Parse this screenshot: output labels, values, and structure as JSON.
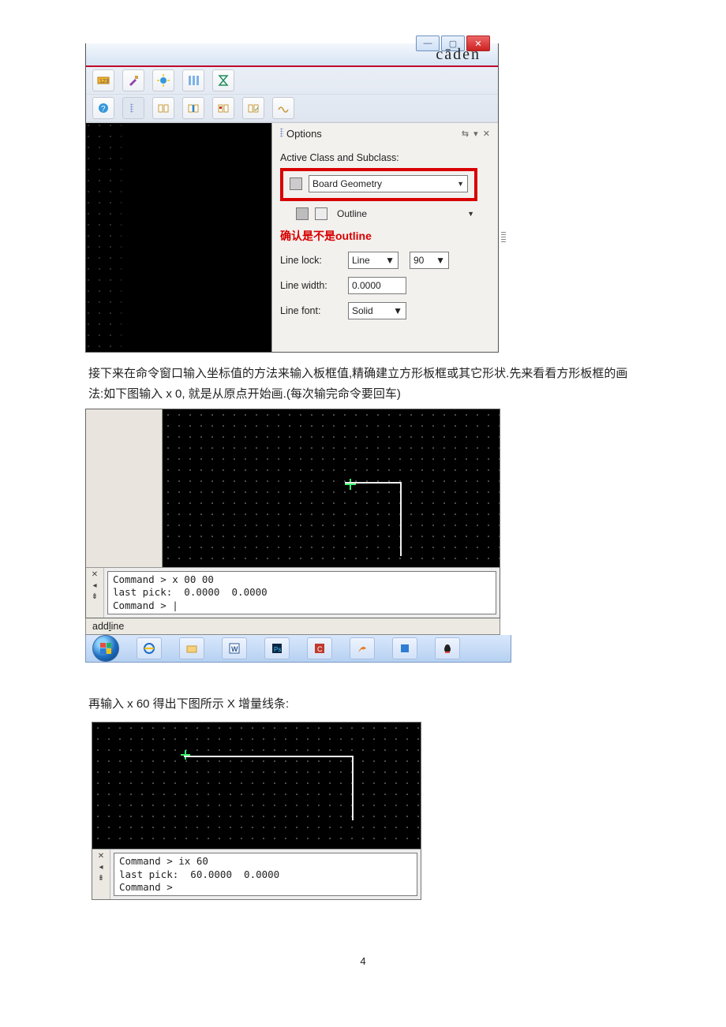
{
  "brand": "cāden",
  "options": {
    "title": "Options",
    "subclassLabel": "Active Class and Subclass:",
    "class": "Board Geometry",
    "subclass": "Outline",
    "note": "确认是不是outline",
    "lineLockLabel": "Line lock:",
    "lineLockMode": "Line",
    "lineLockAngle": "90",
    "lineWidthLabel": "Line width:",
    "lineWidth": "0.0000",
    "lineFontLabel": "Line font:",
    "lineFont": "Solid"
  },
  "para1": "接下来在命令窗口输入坐标值的方法来输入板框值,精确建立方形板框或其它形状.先来看看方形板框的画法:如下图输入 x 0,  就是从原点开始画.(每次输完命令要回车)",
  "cmd1": {
    "line1": "Command > x 00 00",
    "line2": "last pick:  0.0000  0.0000",
    "line3": "Command > "
  },
  "status1_pre": "add ",
  "status1_u": "l",
  "status1_post": "ine",
  "para2": "再输入 x 60  得出下图所示 X 增量线条:",
  "cmd2": {
    "line1": "Command > ix 60",
    "line2": "last pick:  60.0000  0.0000",
    "line3": "Command >"
  },
  "pageNumber": "4"
}
